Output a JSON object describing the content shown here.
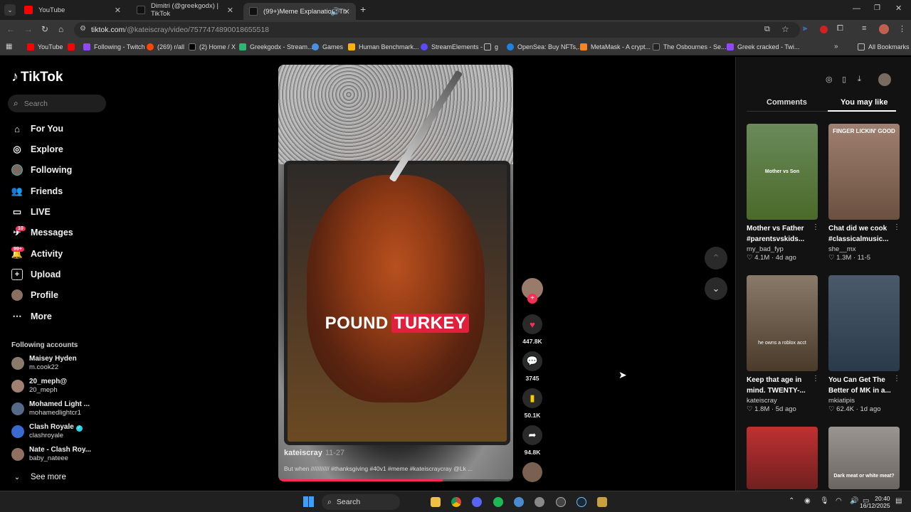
{
  "browser": {
    "tabs": [
      {
        "title": "YouTube",
        "color": "#ff0000"
      },
      {
        "title": "Dimitri (@greekgodx) | TikTok",
        "color": "#111111"
      },
      {
        "title": "(99+)Meme Explanation: Th",
        "color": "#111111",
        "active": true
      }
    ],
    "new_tab": "+",
    "url_host": "tiktok.com",
    "url_path": "/@kateiscray/video/7577474890018655518",
    "bookmarks": [
      {
        "label": "YouTube",
        "color": "#ff0000"
      },
      {
        "label": "Following - Twitch",
        "color": "#9146ff"
      },
      {
        "label": "(269) r/all",
        "color": "#ff4500"
      },
      {
        "label": "(2) Home / X",
        "color": "#000000"
      },
      {
        "label": "Greekgodx - Stream...",
        "color": "#2bb673"
      },
      {
        "label": "Games",
        "color": "#4a90e2"
      },
      {
        "label": "Human Benchmark...",
        "color": "#ffb100"
      },
      {
        "label": "StreamElements -",
        "color": "#5a4bff"
      },
      {
        "label": "g",
        "color": "#666666"
      },
      {
        "label": "OpenSea: Buy NFTs,...",
        "color": "#2081e2"
      },
      {
        "label": "MetaMask - A crypt...",
        "color": "#f6851b"
      },
      {
        "label": "The Osbournes - Se...",
        "color": "#222222"
      },
      {
        "label": "Greek cracked - Twi...",
        "color": "#9146ff"
      }
    ],
    "all_bookmarks": "All Bookmarks"
  },
  "sidebar": {
    "logo": "TikTok",
    "search_placeholder": "Search",
    "nav": [
      {
        "label": "For You",
        "icon": "home-icon"
      },
      {
        "label": "Explore",
        "icon": "compass-icon"
      },
      {
        "label": "Following",
        "icon": "avatar-icon"
      },
      {
        "label": "Friends",
        "icon": "friends-icon"
      },
      {
        "label": "LIVE",
        "icon": "live-icon"
      },
      {
        "label": "Messages",
        "icon": "messages-icon",
        "badge": "10"
      },
      {
        "label": "Activity",
        "icon": "activity-icon",
        "badge": "99+"
      },
      {
        "label": "Upload",
        "icon": "upload-icon"
      },
      {
        "label": "Profile",
        "icon": "profile-icon"
      },
      {
        "label": "More",
        "icon": "more-icon"
      }
    ],
    "following_title": "Following accounts",
    "accounts": [
      {
        "name": "Maisey Hyden",
        "handle": "m.cook22",
        "color": "#8a7a6a"
      },
      {
        "name": "20_meph@",
        "handle": "20_meph",
        "color": "#a08070"
      },
      {
        "name": "Mohamed Light ...",
        "handle": "mohamedlightcr1",
        "color": "#556a88"
      },
      {
        "name": "Clash Royale",
        "handle": "clashroyale",
        "color": "#3a6ad0",
        "verified": true
      },
      {
        "name": "Nate - Clash Roy...",
        "handle": "baby_nateee",
        "color": "#907060"
      }
    ],
    "see_more": "See more"
  },
  "video": {
    "caption_word1": "POUND",
    "caption_word2": "TURKEY",
    "author": "kateiscray",
    "date": "11-27",
    "description": "But when /////////// #thanksgiving #40v1 #meme #kateiscraycray @Lk ...",
    "progress": 0.7
  },
  "actions": {
    "likes": "447.8K",
    "comments": "3745",
    "saves": "50.1K",
    "shares": "94.8K"
  },
  "right_panel": {
    "tab_comments": "Comments",
    "tab_you_may_like": "You may like",
    "cards": [
      {
        "title1": "Mother vs Father",
        "title2": "#parentsvskids...",
        "user": "my_bad_fyp",
        "likes": "4.1M",
        "age": "4d ago",
        "overlay": "Mother vs Son",
        "bg": "#5a7a3a"
      },
      {
        "title1": "Chat did we cook",
        "title2": "#classicalmusic...",
        "user": "she__mx",
        "likes": "1.3M",
        "age": "11-5",
        "overlay": "FINGER LICKIN' GOOD",
        "bg": "#8a6a55"
      },
      {
        "title1": "Keep that age in",
        "title2": "mind. TWENTY-...",
        "user": "kateiscray",
        "likes": "1.8M",
        "age": "5d ago",
        "overlay": "he owns a roblox acct",
        "bg": "#6a5a4a"
      },
      {
        "title1": "You Can Get The",
        "title2": "Better of MK in a...",
        "user": "mkiatipis",
        "likes": "62.4K",
        "age": "1d ago",
        "overlay": "",
        "bg": "#3a4a5a"
      },
      {
        "title1": "",
        "title2": "",
        "user": "",
        "likes": "",
        "age": "",
        "overlay": "",
        "bg": "#a02a2a"
      },
      {
        "title1": "",
        "title2": "",
        "user": "",
        "likes": "",
        "age": "",
        "overlay": "Dark meat or white meat?",
        "bg": "#8a8580"
      }
    ]
  },
  "taskbar": {
    "search": "Search",
    "time": "20:40",
    "date": "16/12/2025"
  }
}
